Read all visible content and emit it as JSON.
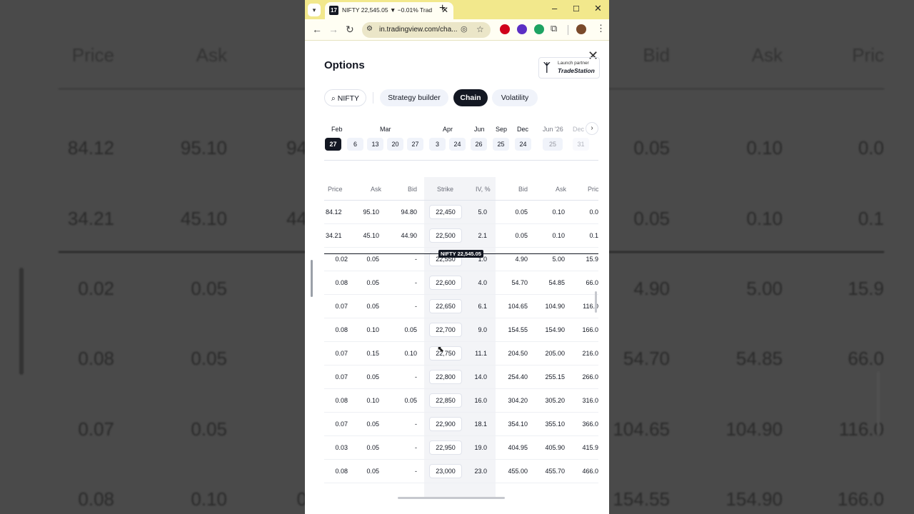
{
  "browser": {
    "tab_title": "NIFTY 22,545.05 ▼ −0.01% Trad",
    "tab_favicon": "tradingview-logo-icon",
    "new_tab": "+",
    "url": "in.tradingview.com/cha...",
    "window_controls": [
      "–",
      "☐",
      "✕"
    ]
  },
  "dialog": {
    "title": "Options",
    "partner_small": "Launch partner",
    "partner_name": "TradeStation",
    "search_label": "NIFTY",
    "tabs": [
      {
        "label": "Strategy builder",
        "active": false
      },
      {
        "label": "Chain",
        "active": true
      },
      {
        "label": "Volatility",
        "active": false
      }
    ],
    "months": [
      "Feb",
      "Mar",
      "Apr",
      "Jun",
      "Sep",
      "Dec",
      "Jun '26",
      "Dec"
    ],
    "dates": [
      "27",
      "6",
      "13",
      "20",
      "27",
      "3",
      "24",
      "26",
      "25",
      "24",
      "25",
      "31"
    ]
  },
  "table": {
    "headers": [
      "Price",
      "Ask",
      "Bid",
      "Strike",
      "IV, %",
      "Bid",
      "Ask",
      "Price"
    ],
    "atm_label": "NIFTY 22,545.05",
    "rows": [
      [
        "84.12",
        "95.10",
        "94.80",
        "22,450",
        "5.0",
        "0.05",
        "0.10",
        "0.0"
      ],
      [
        "34.21",
        "45.10",
        "44.90",
        "22,500",
        "2.1",
        "0.05",
        "0.10",
        "0.1"
      ],
      [
        "0.02",
        "0.05",
        "-",
        "22,550",
        "1.0",
        "4.90",
        "5.00",
        "15.9"
      ],
      [
        "0.08",
        "0.05",
        "-",
        "22,600",
        "4.0",
        "54.70",
        "54.85",
        "66.0"
      ],
      [
        "0.07",
        "0.05",
        "-",
        "22,650",
        "6.1",
        "104.65",
        "104.90",
        "116.0"
      ],
      [
        "0.08",
        "0.10",
        "0.05",
        "22,700",
        "9.0",
        "154.55",
        "154.90",
        "166.0"
      ],
      [
        "0.07",
        "0.15",
        "0.10",
        "22,750",
        "11.1",
        "204.50",
        "205.00",
        "216.0"
      ],
      [
        "0.07",
        "0.05",
        "-",
        "22,800",
        "14.0",
        "254.40",
        "255.15",
        "266.0"
      ],
      [
        "0.08",
        "0.10",
        "0.05",
        "22,850",
        "16.0",
        "304.20",
        "305.20",
        "316.0"
      ],
      [
        "0.07",
        "0.05",
        "-",
        "22,900",
        "18.1",
        "354.10",
        "355.10",
        "366.0"
      ],
      [
        "0.03",
        "0.05",
        "-",
        "22,950",
        "19.0",
        "404.95",
        "405.90",
        "415.9"
      ],
      [
        "0.08",
        "0.05",
        "-",
        "23,000",
        "23.0",
        "455.00",
        "455.70",
        "466.0"
      ]
    ]
  },
  "background": {
    "header": [
      "Price",
      "Ask",
      "Bid",
      "Ask",
      "Pric"
    ],
    "rows": [
      [
        "84.12",
        "95.10",
        "94",
        "0.05",
        "0.10",
        "0.0"
      ],
      [
        "34.21",
        "45.10",
        "44",
        "0.05",
        "0.10",
        "0.1"
      ],
      [
        "0.02",
        "0.05",
        "",
        "4.90",
        "5.00",
        "15.9"
      ],
      [
        "0.08",
        "0.05",
        "",
        "54.70",
        "54.85",
        "66.0"
      ],
      [
        "0.07",
        "0.05",
        "",
        "104.65",
        "104.90",
        "116.0"
      ],
      [
        "0.08",
        "0.10",
        "0",
        "154.55",
        "154.90",
        "166.0"
      ]
    ]
  }
}
